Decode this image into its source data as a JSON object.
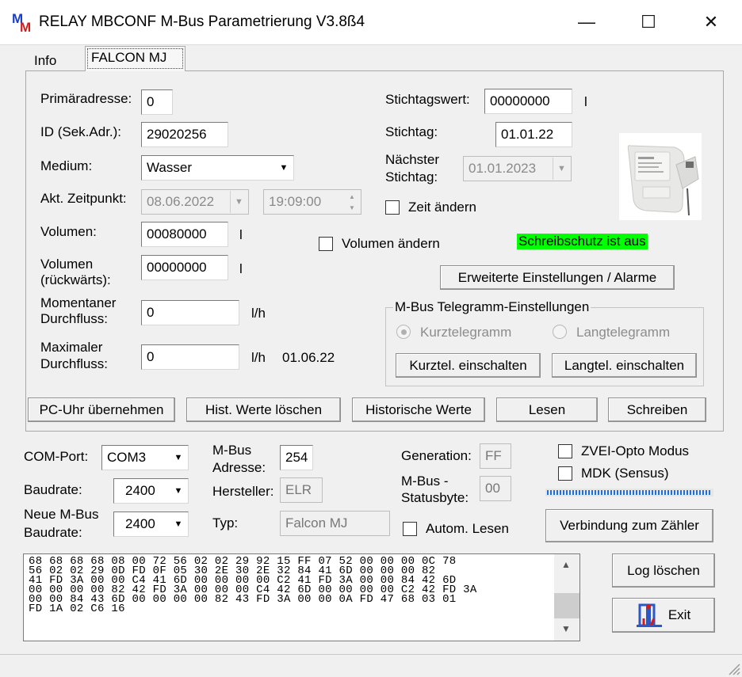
{
  "window": {
    "title": "RELAY MBCONF  M-Bus Parametrierung  V3.8ß4",
    "minimize": "—",
    "maximize": "☐",
    "close": "✕"
  },
  "tabs": [
    {
      "label": "Info",
      "active": false
    },
    {
      "label": "FALCON MJ",
      "active": true
    }
  ],
  "falcon": {
    "primaeradresse_label": "Primäradresse:",
    "primaeradresse_value": "0",
    "id_label": "ID (Sek.Adr.):",
    "id_value": "29020256",
    "medium_label": "Medium:",
    "medium_value": "Wasser",
    "zeitpunkt_label": "Akt. Zeitpunkt:",
    "zeitpunkt_date": "08.06.2022",
    "zeitpunkt_time": "19:09:00",
    "volumen_label": "Volumen:",
    "volumen_value": "00080000",
    "volumen_unit": "l",
    "volumen_rueck_label1": "Volumen",
    "volumen_rueck_label2": "(rückwärts):",
    "volumen_rueck_value": "00000000",
    "volumen_rueck_unit": "l",
    "momentan_label1": "Momentaner",
    "momentan_label2": "Durchfluss:",
    "momentan_value": "0",
    "momentan_unit": "l/h",
    "maximal_label1": "Maximaler",
    "maximal_label2": "Durchfluss:",
    "maximal_value": "0",
    "maximal_unit": "l/h",
    "maximal_date": "01.06.22",
    "stichtagswert_label": "Stichtagswert:",
    "stichtagswert_value": "00000000",
    "stichtagswert_unit": "l",
    "stichtag_label": "Stichtag:",
    "stichtag_value": "01.01.22",
    "naechster_label1": "Nächster",
    "naechster_label2": "Stichtag:",
    "naechster_value": "01.01.2023",
    "zeit_aendern_label": "Zeit ändern",
    "volumen_aendern_label": "Volumen ändern",
    "schreibschutz": "Schreibschutz ist aus",
    "erweiterte_button": "Erweiterte Einstellungen / Alarme",
    "telegramm_group_title": "M-Bus Telegramm-Einstellungen",
    "kurztelegramm_label": "Kurztelegramm",
    "langtelegramm_label": "Langtelegramm",
    "kurztel_button": "Kurztel. einschalten",
    "langtel_button": "Langtel. einschalten",
    "pc_uhr_button": "PC-Uhr übernehmen",
    "hist_loeschen_button": "Hist. Werte löschen",
    "historische_button": "Historische Werte",
    "lesen_button": "Lesen",
    "schreiben_button": "Schreiben"
  },
  "connection": {
    "com_port_label": "COM-Port:",
    "com_port_value": "COM3",
    "baudrate_label": "Baudrate:",
    "baudrate_value": "2400",
    "neue_baud_label1": "Neue M-Bus",
    "neue_baud_label2": "Baudrate:",
    "neue_baud_value": "2400",
    "mbus_adresse_label1": "M-Bus",
    "mbus_adresse_label2": "Adresse:",
    "mbus_adresse_value": "254",
    "hersteller_label": "Hersteller:",
    "hersteller_value": "ELR",
    "typ_label": "Typ:",
    "typ_value": "Falcon MJ",
    "generation_label": "Generation:",
    "generation_value": "FF",
    "statusbyte_label1": "M-Bus -",
    "statusbyte_label2": "Statusbyte:",
    "statusbyte_value": "00",
    "zvei_label": "ZVEI-Opto Modus",
    "mdk_label": "MDK (Sensus)",
    "autom_lesen_label": "Autom. Lesen",
    "verbindung_button": "Verbindung zum Zähler",
    "log_loeschen_button": "Log löschen",
    "exit_button": "Exit"
  },
  "log": {
    "text": "68 68 68 68 08 00 72 56 02 02 29 92 15 FF 07 52 00 00 00 0C 78\n56 02 02 29 0D FD 0F 05 30 2E 30 2E 32 84 41 6D 00 00 00 82\n41 FD 3A 00 00 C4 41 6D 00 00 00 00 C2 41 FD 3A 00 00 84 42 6D\n00 00 00 00 82 42 FD 3A 00 00 00 C4 42 6D 00 00 00 00 C2 42 FD 3A\n00 00 84 43 6D 00 00 00 00 82 43 FD 3A 00 00 0A FD 47 68 03 01\nFD 1A 02 C6 16"
  },
  "colors": {
    "schreibschutz_bg": "#00ff00",
    "progress_fill": "#1e6fd6",
    "exit_icon": "#2b57c7"
  }
}
